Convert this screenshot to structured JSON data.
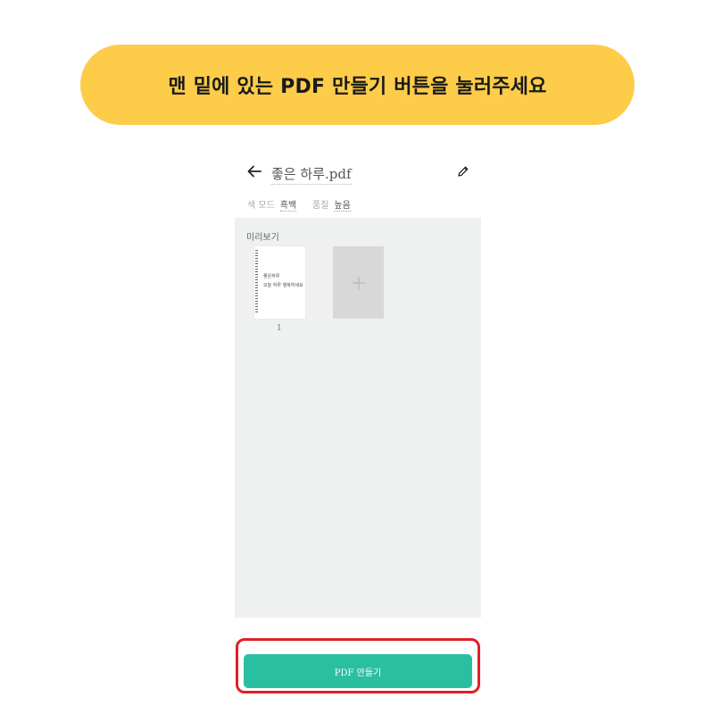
{
  "banner": {
    "text": "맨 밑에 있는 PDF 만들기 버튼을 눌러주세요"
  },
  "header": {
    "title": "좋은 하루.pdf",
    "back_icon": "arrow-left-icon",
    "edit_icon": "pencil-icon"
  },
  "options": {
    "color_mode_label": "색 모드",
    "color_mode_value": "흑백",
    "quality_label": "품질",
    "quality_value": "높음"
  },
  "preview": {
    "label": "미리보기",
    "pages": [
      {
        "number": "1",
        "line1": "좋은하루",
        "line2": "오늘 하루 행복하세요"
      }
    ],
    "add_icon": "plus-icon"
  },
  "action": {
    "make_pdf_label": "PDF 만들기",
    "highlight_color": "#e02025",
    "button_color": "#2bbfa2"
  },
  "colors": {
    "banner": "#fdcc48",
    "preview_bg": "#eff0f0"
  }
}
